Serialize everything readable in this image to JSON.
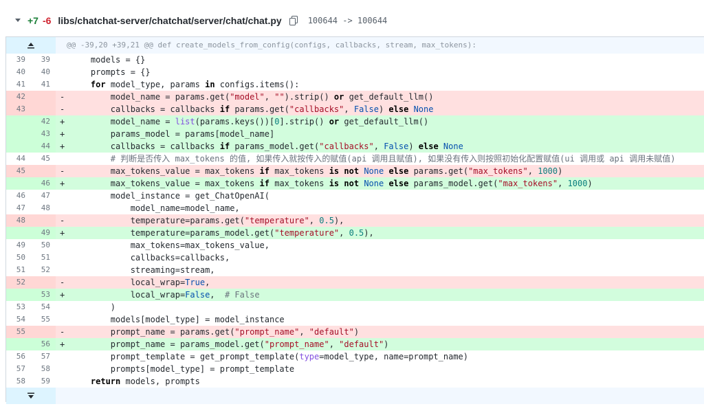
{
  "header": {
    "additions": "+7",
    "deletions": "-6",
    "file_path": "libs/chatchat-server/chatchat/server/chat/chat.py",
    "mode_change": "100644 -> 100644"
  },
  "hunk_header": "@@ -39,20 +39,21 @@ def create_models_from_config(configs, callbacks, stream, max_tokens):",
  "icons": {
    "collapse": "chevron-down-icon",
    "copy": "copy-icon",
    "expand_up": "expand-up-icon",
    "expand_down": "expand-down-icon"
  },
  "lines": [
    {
      "type": "ctx",
      "old": "39",
      "new": "39",
      "code": "    models = {}"
    },
    {
      "type": "ctx",
      "old": "40",
      "new": "40",
      "code": "    prompts = {}"
    },
    {
      "type": "ctx",
      "old": "41",
      "new": "41",
      "code": "    for model_type, params in configs.items():"
    },
    {
      "type": "del",
      "old": "42",
      "new": "",
      "code": "        model_name = params.get(\"model\", \"\").strip() or get_default_llm()"
    },
    {
      "type": "del",
      "old": "43",
      "new": "",
      "code": "        callbacks = callbacks if params.get(\"callbacks\", False) else None"
    },
    {
      "type": "add",
      "old": "",
      "new": "42",
      "code": "        model_name = list(params.keys())[0].strip() or get_default_llm()"
    },
    {
      "type": "add",
      "old": "",
      "new": "43",
      "code": "        params_model = params[model_name]"
    },
    {
      "type": "add",
      "old": "",
      "new": "44",
      "code": "        callbacks = callbacks if params_model.get(\"callbacks\", False) else None"
    },
    {
      "type": "ctx",
      "old": "44",
      "new": "45",
      "code": "        # 判断是否传入 max_tokens 的值, 如果传入就按传入的赋值(api 调用且赋值), 如果没有传入则按照初始化配置赋值(ui 调用或 api 调用未赋值)"
    },
    {
      "type": "del",
      "old": "45",
      "new": "",
      "code": "        max_tokens_value = max_tokens if max_tokens is not None else params.get(\"max_tokens\", 1000)"
    },
    {
      "type": "add",
      "old": "",
      "new": "46",
      "code": "        max_tokens_value = max_tokens if max_tokens is not None else params_model.get(\"max_tokens\", 1000)"
    },
    {
      "type": "ctx",
      "old": "46",
      "new": "47",
      "code": "        model_instance = get_ChatOpenAI("
    },
    {
      "type": "ctx",
      "old": "47",
      "new": "48",
      "code": "            model_name=model_name,"
    },
    {
      "type": "del",
      "old": "48",
      "new": "",
      "code": "            temperature=params.get(\"temperature\", 0.5),"
    },
    {
      "type": "add",
      "old": "",
      "new": "49",
      "code": "            temperature=params_model.get(\"temperature\", 0.5),"
    },
    {
      "type": "ctx",
      "old": "49",
      "new": "50",
      "code": "            max_tokens=max_tokens_value,"
    },
    {
      "type": "ctx",
      "old": "50",
      "new": "51",
      "code": "            callbacks=callbacks,"
    },
    {
      "type": "ctx",
      "old": "51",
      "new": "52",
      "code": "            streaming=stream,"
    },
    {
      "type": "del",
      "old": "52",
      "new": "",
      "code": "            local_wrap=True,"
    },
    {
      "type": "add",
      "old": "",
      "new": "53",
      "code": "            local_wrap=False,  # False"
    },
    {
      "type": "ctx",
      "old": "53",
      "new": "54",
      "code": "        )"
    },
    {
      "type": "ctx",
      "old": "54",
      "new": "55",
      "code": "        models[model_type] = model_instance"
    },
    {
      "type": "del",
      "old": "55",
      "new": "",
      "code": "        prompt_name = params.get(\"prompt_name\", \"default\")"
    },
    {
      "type": "add",
      "old": "",
      "new": "56",
      "code": "        prompt_name = params_model.get(\"prompt_name\", \"default\")"
    },
    {
      "type": "ctx",
      "old": "56",
      "new": "57",
      "code": "        prompt_template = get_prompt_template(type=model_type, name=prompt_name)"
    },
    {
      "type": "ctx",
      "old": "57",
      "new": "58",
      "code": "        prompts[model_type] = prompt_template"
    },
    {
      "type": "ctx",
      "old": "58",
      "new": "59",
      "code": "    return models, prompts"
    }
  ]
}
